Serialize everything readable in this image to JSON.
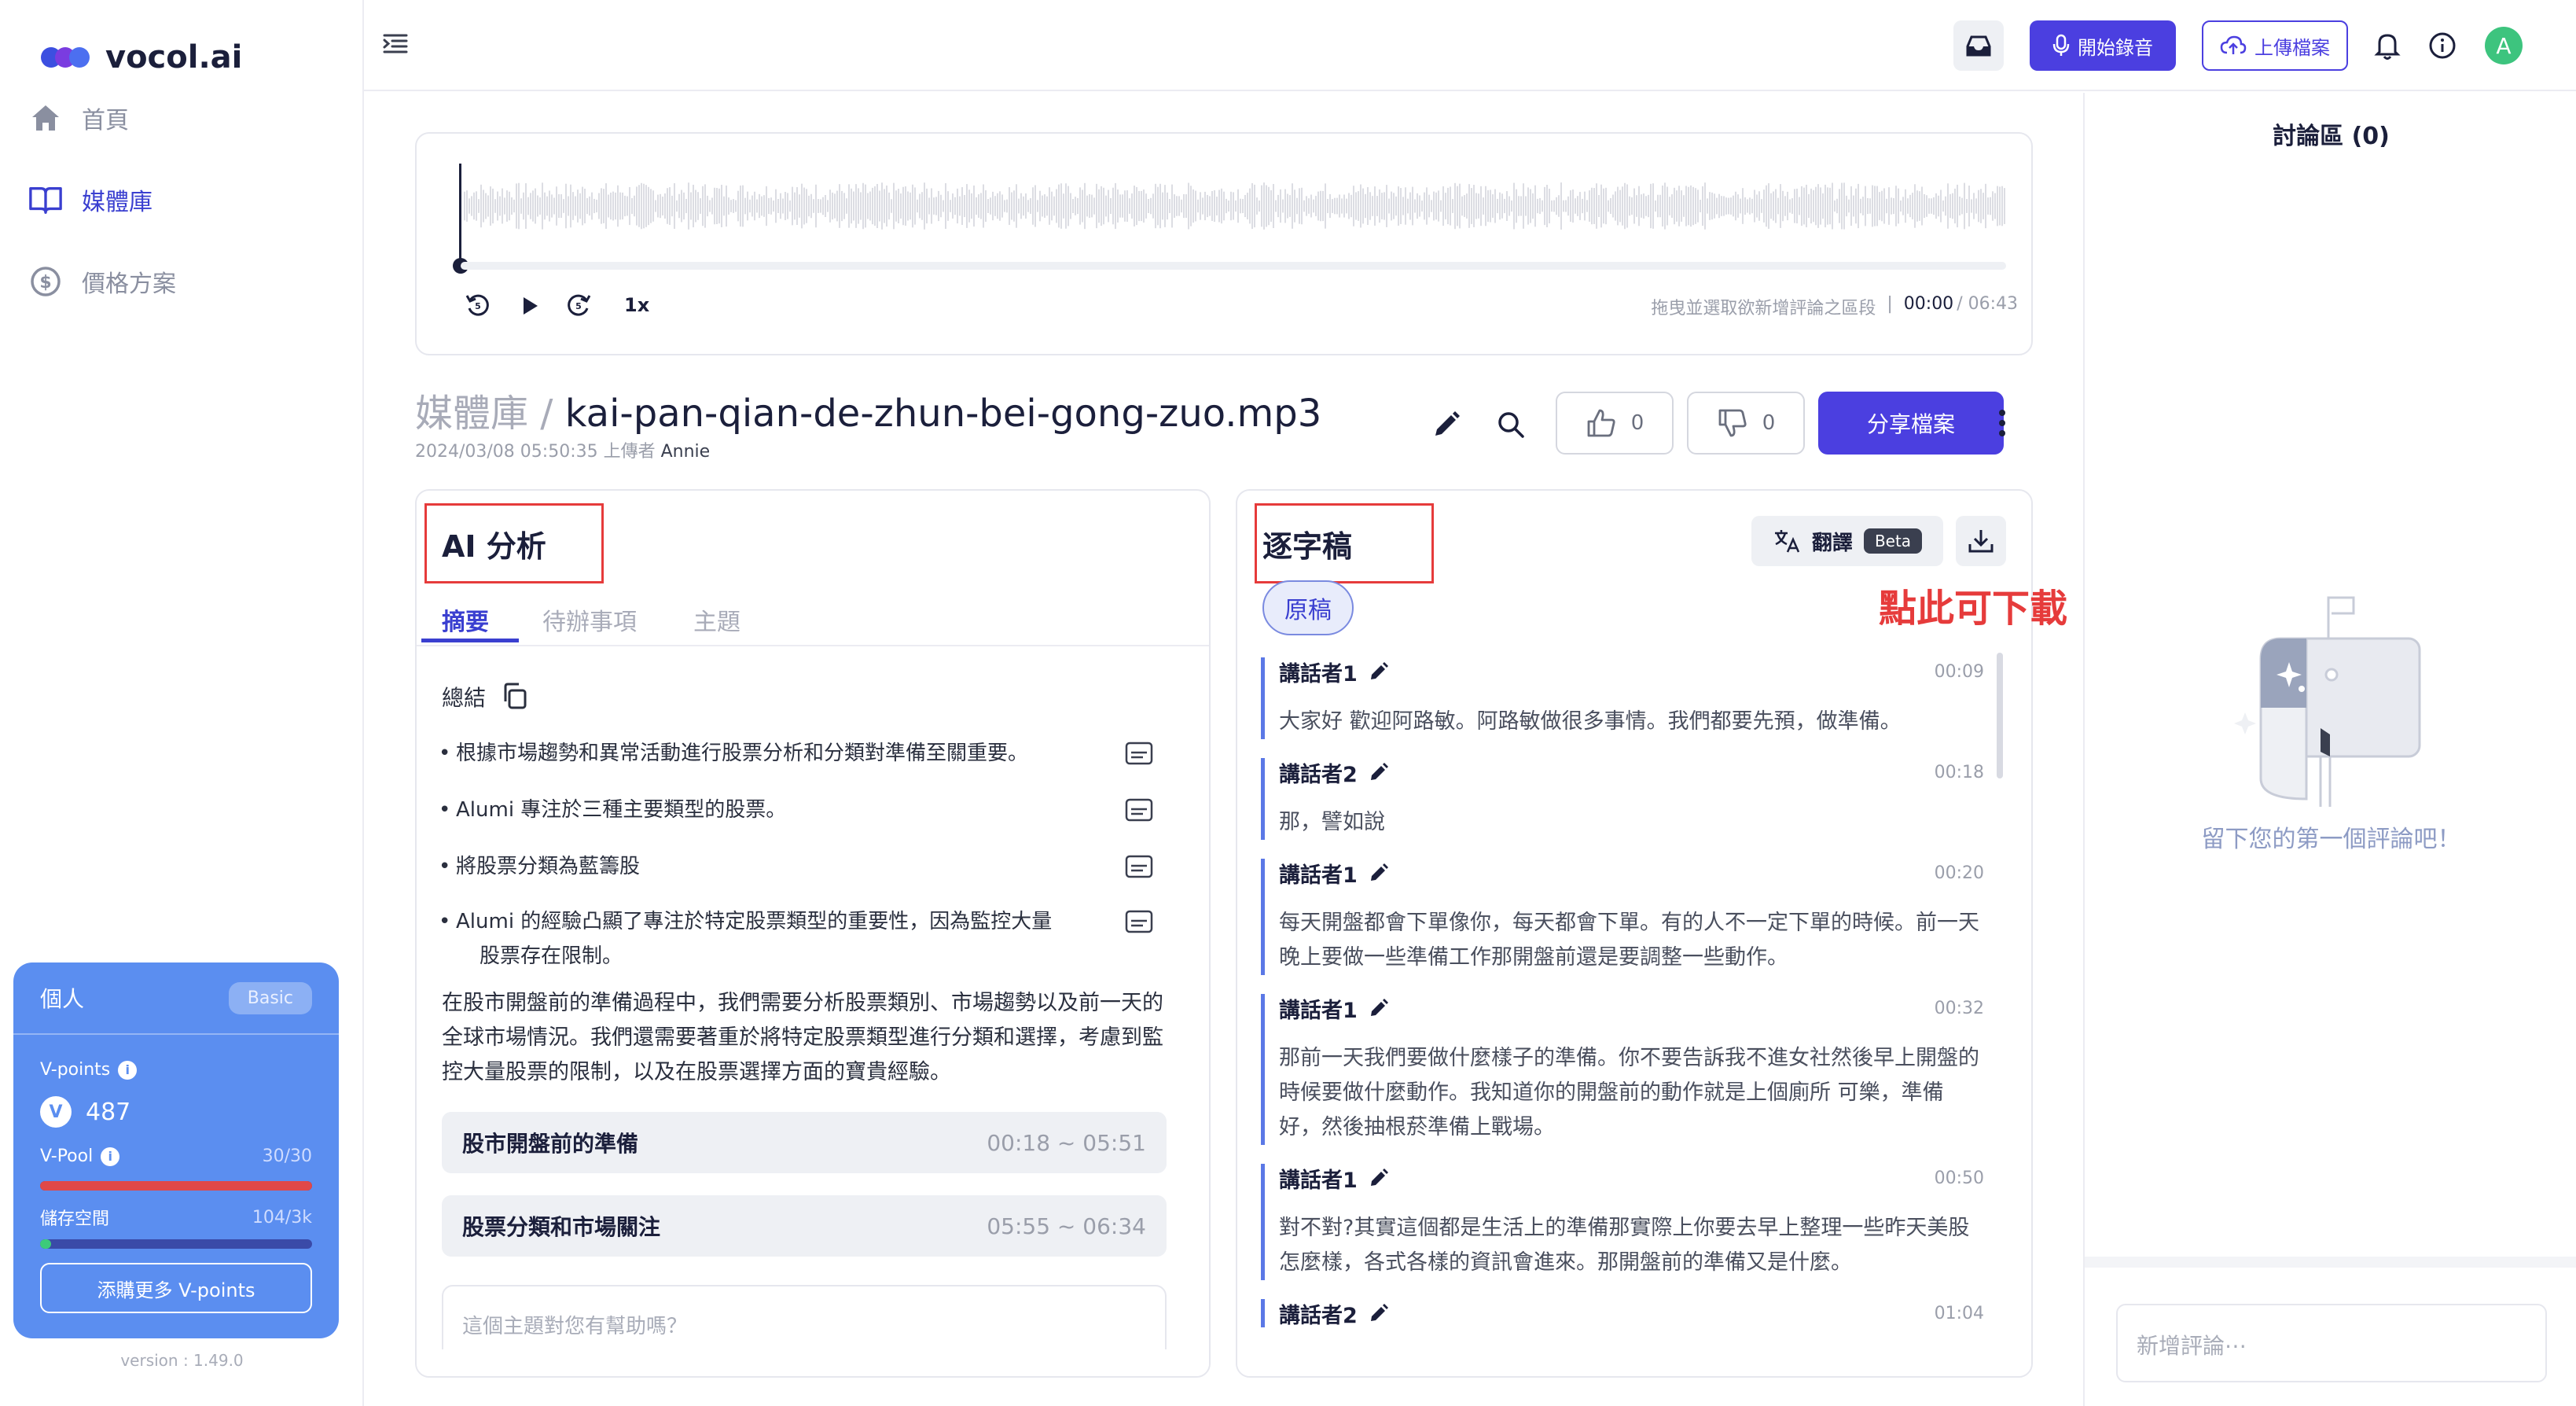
{
  "app": {
    "logo_text": "vocol.ai"
  },
  "sidebar": {
    "items": [
      {
        "label": "首頁",
        "icon": "home-icon"
      },
      {
        "label": "媒體庫",
        "icon": "book-icon"
      },
      {
        "label": "價格方案",
        "icon": "dollar-icon"
      }
    ],
    "plan": {
      "title": "個人",
      "badge": "Basic",
      "vpoints_label": "V-points",
      "vpoints_value": "487",
      "vpool_label": "V-Pool",
      "vpool_value": "30/30",
      "vpool_fraction": 1.0,
      "storage_label": "儲存空間",
      "storage_value": "104/3k",
      "storage_fraction": 0.035,
      "add_button": "添購更多 V-points"
    },
    "version": "version : 1.49.0"
  },
  "topbar": {
    "record_button": "開始錄音",
    "upload_button": "上傳檔案",
    "avatar_letter": "A"
  },
  "player": {
    "hint": "拖曳並選取欲新增評論之區段",
    "separator": "|",
    "current_time": "00:00",
    "total_time": "/ 06:43",
    "speed": "1x"
  },
  "file": {
    "breadcrumb": "媒體庫",
    "breadcrumb_sep": "/",
    "name": "kai-pan-qian-de-zhun-bei-gong-zuo.mp3",
    "meta": "2024/03/08 05:50:35 上傳者",
    "uploader": "Annie",
    "likes": "0",
    "dislikes": "0",
    "share_button": "分享檔案"
  },
  "analysis": {
    "title": "AI 分析",
    "tabs": [
      "摘要",
      "待辦事項",
      "主題"
    ],
    "summary_label": "總結",
    "bullets": [
      "根據市場趨勢和異常活動進行股票分析和分類對準備至關重要。",
      "Alumi 專注於三種主要類型的股票。",
      "將股票分類為藍籌股",
      "Alumi 的經驗凸顯了專注於特定股票類型的重要性，因為監控大量",
      "股票存在限制。"
    ],
    "paragraph": [
      "在股市開盤前的準備過程中，我們需要分析股票類別、市場趨勢以及前一天的",
      "全球市場情況。我們還需要著重於將特定股票類型進行分類和選擇，考慮到監",
      "控大量股票的限制，以及在股票選擇方面的寶貴經驗。"
    ],
    "chapters": [
      {
        "name": "股市開盤前的準備",
        "time": "00:18 ~ 05:51"
      },
      {
        "name": "股票分類和市場關注",
        "time": "05:55 ~ 06:34"
      }
    ],
    "ask_placeholder": "這個主題對您有幫助嗎？"
  },
  "transcript": {
    "title": "逐字稿",
    "translate_label": "翻譯",
    "beta_badge": "Beta",
    "original_chip": "原稿",
    "download_hint": "點此可下載",
    "segments": [
      {
        "speaker": "講話者1",
        "time": "00:09",
        "lines": [
          "大家好 歡迎阿路敏。阿路敏做很多事情。我們都要先預，做準備。"
        ]
      },
      {
        "speaker": "講話者2",
        "time": "00:18",
        "lines": [
          "那，譬如說"
        ]
      },
      {
        "speaker": "講話者1",
        "time": "00:20",
        "lines": [
          "每天開盤都會下單像你，每天都會下單。有的人不一定下單的時候。前一天",
          "晚上要做一些準備工作那開盤前還是要調整一些動作。"
        ]
      },
      {
        "speaker": "講話者1",
        "time": "00:32",
        "lines": [
          "那前一天我們要做什麼樣子的準備。你不要告訴我不進女社然後早上開盤的",
          "時候要做什麼動作。我知道你的開盤前的動作就是上個廁所 可樂，準備",
          "好，然後抽根菸準備上戰場。"
        ]
      },
      {
        "speaker": "講話者1",
        "time": "00:50",
        "lines": [
          "對不對?其實這個都是生活上的準備那實際上你要去早上整理一些昨天美股",
          "怎麼樣，各式各樣的資訊會進來。那開盤前的準備又是什麼。"
        ]
      },
      {
        "speaker": "講話者2",
        "time": "01:04",
        "lines": []
      }
    ]
  },
  "discussion": {
    "title": "討論區 (0)",
    "empty_text": "留下您的第一個評論吧！",
    "input_placeholder": "新增評論⋯"
  },
  "colors": {
    "accent": "#4b3fe0",
    "highlight_red": "#e63b3b",
    "plan_blue": "#5b8ef0"
  }
}
